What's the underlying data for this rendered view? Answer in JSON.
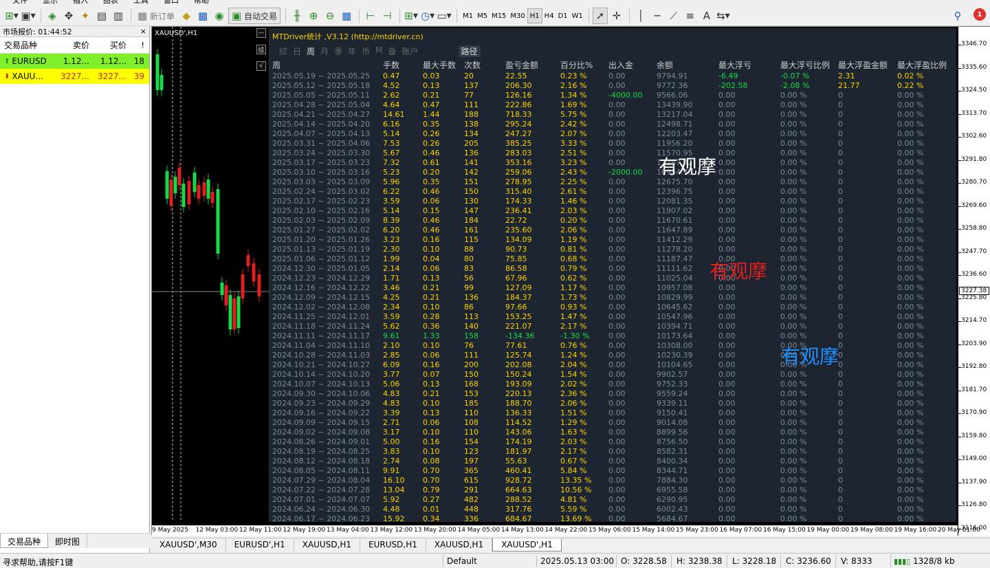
{
  "toolbar": {
    "menu": [
      "文件",
      "显示",
      "插入",
      "图表",
      "工具",
      "窗口",
      "帮助"
    ],
    "new_order_label": "新订单",
    "auto_trade_label": "自动交易",
    "timeframes": [
      "M1",
      "M5",
      "M15",
      "M30",
      "H1",
      "H4",
      "D1",
      "W1"
    ],
    "active_timeframe": "H1",
    "notifications": "1"
  },
  "market_watch": {
    "title": "市场报价: 01:44:52",
    "close": "×",
    "columns": [
      "交易品种",
      "卖价",
      "买价",
      "!"
    ],
    "rows": [
      {
        "symbol": "EURUSD",
        "bid": "1.12...",
        "ask": "1.12...",
        "spread": "18",
        "bg": "#7ff02a"
      },
      {
        "symbol": "XAUU...",
        "bid": "3227...",
        "ask": "3227...",
        "spread": "39",
        "bg": "#ffff00"
      }
    ],
    "tabs": [
      "交易品种",
      "即时图"
    ]
  },
  "chart": {
    "label": "XAUUSD',H1",
    "price_ticks": [
      "3346.70",
      "3335.60",
      "3324.50",
      "3313.70",
      "3302.60",
      "3291.80",
      "3280.70",
      "3269.60",
      "3258.80",
      "3247.70",
      "3236.60",
      "3225.80",
      "3214.70",
      "3203.90",
      "3192.80",
      "3181.70",
      "3170.90",
      "3159.80",
      "3149.00",
      "3137.90",
      "3126.80",
      "3116.00"
    ],
    "current_price": "3227.38",
    "time_ticks": [
      "9 May 2025",
      "12 May 03:00",
      "12 May 11:00",
      "12 May 19:00",
      "13 May 04:00",
      "13 May 12:00",
      "13 May 20:00",
      "14 May 05:00",
      "14 May 13:00",
      "14 May 22:00",
      "15 May 06:00",
      "15 May 14:00",
      "15 May 23:00",
      "16 May 07:00",
      "16 May 15:00",
      "19 May 00:00",
      "19 May 08:00",
      "19 May 16:00",
      "20 May 01:00"
    ],
    "side_buttons": [
      "—",
      "综",
      "√"
    ]
  },
  "panel": {
    "title": "MTDriver统计 ,V3.12 (http://mtdriver.cn)",
    "tabs": [
      "综",
      "日",
      "周",
      "月",
      "季",
      "年",
      "币",
      "M",
      "备",
      "账户"
    ],
    "route": "路径",
    "headers": [
      "周",
      "手数",
      "最大手数",
      "次数",
      "盈亏金额",
      "百分比%",
      "出入金",
      "余额",
      "最大浮亏",
      "最大浮亏比例",
      "最大浮盈金额",
      "最大浮盈比例"
    ],
    "rows": [
      [
        "2025.05.19 ~ 2025.05.25",
        "0.47",
        "0.03",
        "20",
        "22.55",
        "0.23 %",
        "0.00",
        "9794.91",
        "-6.49",
        "-0.07 %",
        "2.31",
        "0.02 %"
      ],
      [
        "2025.05.12 ~ 2025.05.18",
        "4.52",
        "0.13",
        "137",
        "206.30",
        "2.16 %",
        "0.00",
        "9772.36",
        "-202.58",
        "-2.08 %",
        "21.77",
        "0.22 %"
      ],
      [
        "2025.05.05 ~ 2025.05.11",
        "2.62",
        "0.21",
        "77",
        "126.16",
        "1.34 %",
        "-4000.00",
        "9566.06",
        "0.00",
        "0.00 %",
        "0",
        "0.00 %"
      ],
      [
        "2025.04.28 ~ 2025.05.04",
        "4.64",
        "0.47",
        "111",
        "222.86",
        "1.69 %",
        "0.00",
        "13439.90",
        "0.00",
        "0.00 %",
        "0",
        "0.00 %"
      ],
      [
        "2025.04.21 ~ 2025.04.27",
        "14.61",
        "1.44",
        "188",
        "718.33",
        "5.75 %",
        "0.00",
        "13217.04",
        "0.00",
        "0.00 %",
        "0",
        "0.00 %"
      ],
      [
        "2025.04.14 ~ 2025.04.20",
        "6.16",
        "0.35",
        "138",
        "295.24",
        "2.42 %",
        "0.00",
        "12498.71",
        "0.00",
        "0.00 %",
        "0",
        "0.00 %"
      ],
      [
        "2025.04.07 ~ 2025.04.13",
        "5.14",
        "0.26",
        "134",
        "247.27",
        "2.07 %",
        "0.00",
        "12203.47",
        "0.00",
        "0.00 %",
        "0",
        "0.00 %"
      ],
      [
        "2025.03.31 ~ 2025.04.06",
        "7.53",
        "0.26",
        "205",
        "385.25",
        "3.33 %",
        "0.00",
        "11956.20",
        "0.00",
        "0.00 %",
        "0",
        "0.00 %"
      ],
      [
        "2025.03.24 ~ 2025.03.30",
        "5.67",
        "0.46",
        "136",
        "283.03",
        "2.51 %",
        "0.00",
        "11570.95",
        "0.00",
        "0.00 %",
        "0",
        "0.00 %"
      ],
      [
        "2025.03.17 ~ 2025.03.23",
        "7.32",
        "0.61",
        "141",
        "353.16",
        "3.23 %",
        "0.00",
        "11287.92",
        "0.00",
        "0.00 %",
        "0",
        "0.00 %"
      ],
      [
        "2025.03.10 ~ 2025.03.16",
        "5.23",
        "0.20",
        "142",
        "259.06",
        "2.43 %",
        "-2000.00",
        "10934.76",
        "0.00",
        "0.00 %",
        "0",
        "0.00 %"
      ],
      [
        "2025.03.03 ~ 2025.03.09",
        "5.96",
        "0.35",
        "151",
        "278.95",
        "2.25 %",
        "0.00",
        "12675.70",
        "0.00",
        "0.00 %",
        "0",
        "0.00 %"
      ],
      [
        "2025.02.24 ~ 2025.03.02",
        "6.22",
        "0.46",
        "150",
        "315.40",
        "2.61 %",
        "0.00",
        "12396.75",
        "0.00",
        "0.00 %",
        "0",
        "0.00 %"
      ],
      [
        "2025.02.17 ~ 2025.02.23",
        "3.59",
        "0.06",
        "130",
        "174.33",
        "1.46 %",
        "0.00",
        "12081.35",
        "0.00",
        "0.00 %",
        "0",
        "0.00 %"
      ],
      [
        "2025.02.10 ~ 2025.02.16",
        "5.14",
        "0.15",
        "147",
        "236.41",
        "2.03 %",
        "0.00",
        "11907.02",
        "0.00",
        "0.00 %",
        "0",
        "0.00 %"
      ],
      [
        "2025.02.03 ~ 2025.02.09",
        "8.39",
        "0.46",
        "184",
        "22.72",
        "0.20 %",
        "0.00",
        "11670.61",
        "0.00",
        "0.00 %",
        "0",
        "0.00 %"
      ],
      [
        "2025.01.27 ~ 2025.02.02",
        "6.20",
        "0.46",
        "161",
        "235.60",
        "2.06 %",
        "0.00",
        "11647.89",
        "0.00",
        "0.00 %",
        "0",
        "0.00 %"
      ],
      [
        "2025.01.20 ~ 2025.01.26",
        "3.23",
        "0.16",
        "115",
        "134.09",
        "1.19 %",
        "0.00",
        "11412.29",
        "0.00",
        "0.00 %",
        "0",
        "0.00 %"
      ],
      [
        "2025.01.13 ~ 2025.01.19",
        "2.30",
        "0.10",
        "88",
        "90.73",
        "0.81 %",
        "0.00",
        "11278.20",
        "0.00",
        "0.00 %",
        "0",
        "0.00 %"
      ],
      [
        "2025.01.06 ~ 2025.01.12",
        "1.99",
        "0.04",
        "80",
        "75.85",
        "0.68 %",
        "0.00",
        "11187.47",
        "0.00",
        "0.00 %",
        "0",
        "0.00 %"
      ],
      [
        "2024.12.30 ~ 2025.01.05",
        "2.14",
        "0.06",
        "83",
        "86.58",
        "0.79 %",
        "0.00",
        "11111.62",
        "0.00",
        "0.00 %",
        "0",
        "0.00 %"
      ],
      [
        "2024.12.23 ~ 2024.12.29",
        "1.71",
        "0.13",
        "56",
        "67.96",
        "0.62 %",
        "0.00",
        "11025.04",
        "0.00",
        "0.00 %",
        "0",
        "0.00 %"
      ],
      [
        "2024.12.16 ~ 2024.12.22",
        "3.46",
        "0.21",
        "99",
        "127.09",
        "1.17 %",
        "0.00",
        "10957.08",
        "0.00",
        "0.00 %",
        "0",
        "0.00 %"
      ],
      [
        "2024.12.09 ~ 2024.12.15",
        "4.25",
        "0.21",
        "136",
        "184.37",
        "1.73 %",
        "0.00",
        "10829.99",
        "0.00",
        "0.00 %",
        "0",
        "0.00 %"
      ],
      [
        "2024.12.02 ~ 2024.12.08",
        "2.34",
        "0.10",
        "86",
        "97.66",
        "0.93 %",
        "0.00",
        "10645.62",
        "0.00",
        "0.00 %",
        "0",
        "0.00 %"
      ],
      [
        "2024.11.25 ~ 2024.12.01",
        "3.59",
        "0.28",
        "113",
        "153.25",
        "1.47 %",
        "0.00",
        "10547.96",
        "0.00",
        "0.00 %",
        "0",
        "0.00 %"
      ],
      [
        "2024.11.18 ~ 2024.11.24",
        "5.62",
        "0.36",
        "140",
        "221.07",
        "2.17 %",
        "0.00",
        "10394.71",
        "0.00",
        "0.00 %",
        "0",
        "0.00 %"
      ],
      [
        "2024.11.11 ~ 2024.11.17",
        "9.61",
        "1.33",
        "158",
        "-134.36",
        "-1.30 %",
        "0.00",
        "10173.64",
        "0.00",
        "0.00 %",
        "0",
        "0.00 %"
      ],
      [
        "2024.11.04 ~ 2024.11.10",
        "2.10",
        "0.10",
        "76",
        "77.61",
        "0.76 %",
        "0.00",
        "10308.00",
        "0.00",
        "0.00 %",
        "0",
        "0.00 %"
      ],
      [
        "2024.10.28 ~ 2024.11.03",
        "2.85",
        "0.06",
        "111",
        "125.74",
        "1.24 %",
        "0.00",
        "10230.39",
        "0.00",
        "0.00 %",
        "0",
        "0.00 %"
      ],
      [
        "2024.10.21 ~ 2024.10.27",
        "6.09",
        "0.16",
        "200",
        "202.08",
        "2.04 %",
        "0.00",
        "10104.65",
        "0.00",
        "0.00 %",
        "0",
        "0.00 %"
      ],
      [
        "2024.10.14 ~ 2024.10.20",
        "3.77",
        "0.07",
        "150",
        "150.24",
        "1.54 %",
        "0.00",
        "9902.57",
        "0.00",
        "0.00 %",
        "0",
        "0.00 %"
      ],
      [
        "2024.10.07 ~ 2024.10.13",
        "5.06",
        "0.13",
        "168",
        "193.09",
        "2.02 %",
        "0.00",
        "9752.33",
        "0.00",
        "0.00 %",
        "0",
        "0.00 %"
      ],
      [
        "2024.09.30 ~ 2024.10.06",
        "4.83",
        "0.21",
        "153",
        "220.13",
        "2.36 %",
        "0.00",
        "9559.24",
        "0.00",
        "0.00 %",
        "0",
        "0.00 %"
      ],
      [
        "2024.09.23 ~ 2024.09.29",
        "4.83",
        "0.10",
        "185",
        "188.70",
        "2.06 %",
        "0.00",
        "9339.11",
        "0.00",
        "0.00 %",
        "0",
        "0.00 %"
      ],
      [
        "2024.09.16 ~ 2024.09.22",
        "3.39",
        "0.13",
        "110",
        "136.33",
        "1.51 %",
        "0.00",
        "9150.41",
        "0.00",
        "0.00 %",
        "0",
        "0.00 %"
      ],
      [
        "2024.09.09 ~ 2024.09.15",
        "2.71",
        "0.06",
        "108",
        "114.52",
        "1.29 %",
        "0.00",
        "9014.08",
        "0.00",
        "0.00 %",
        "0",
        "0.00 %"
      ],
      [
        "2024.09.02 ~ 2024.09.08",
        "3.17",
        "0.10",
        "110",
        "143.06",
        "1.63 %",
        "0.00",
        "8899.56",
        "0.00",
        "0.00 %",
        "0",
        "0.00 %"
      ],
      [
        "2024.08.26 ~ 2024.09.01",
        "5.00",
        "0.16",
        "154",
        "174.19",
        "2.03 %",
        "0.00",
        "8756.50",
        "0.00",
        "0.00 %",
        "0",
        "0.00 %"
      ],
      [
        "2024.08.19 ~ 2024.08.25",
        "3.83",
        "0.10",
        "123",
        "181.97",
        "2.17 %",
        "0.00",
        "8582.31",
        "0.00",
        "0.00 %",
        "0",
        "0.00 %"
      ],
      [
        "2024.08.12 ~ 2024.08.18",
        "2.74",
        "0.08",
        "197",
        "55.63",
        "0.67 %",
        "0.00",
        "8400.34",
        "0.00",
        "0.00 %",
        "0",
        "0.00 %"
      ],
      [
        "2024.08.05 ~ 2024.08.11",
        "9.91",
        "0.70",
        "365",
        "460.41",
        "5.84 %",
        "0.00",
        "8344.71",
        "0.00",
        "0.00 %",
        "0",
        "0.00 %"
      ],
      [
        "2024.07.29 ~ 2024.08.04",
        "16.10",
        "0.70",
        "615",
        "928.72",
        "13.35 %",
        "0.00",
        "7884.30",
        "0.00",
        "0.00 %",
        "0",
        "0.00 %"
      ],
      [
        "2024.07.22 ~ 2024.07.28",
        "13.04",
        "0.79",
        "291",
        "664.63",
        "10.56 %",
        "0.00",
        "6955.58",
        "0.00",
        "0.00 %",
        "0",
        "0.00 %"
      ],
      [
        "2024.07.01 ~ 2024.07.07",
        "5.92",
        "0.27",
        "482",
        "288.52",
        "4.81 %",
        "0.00",
        "6290.95",
        "0.00",
        "0.00 %",
        "0",
        "0.00 %"
      ],
      [
        "2024.06.24 ~ 2024.06.30",
        "4.48",
        "0.01",
        "448",
        "317.76",
        "5.59 %",
        "0.00",
        "6002.43",
        "0.00",
        "0.00 %",
        "0",
        "0.00 %"
      ],
      [
        "2024.06.17 ~ 2024.06.23",
        "15.92",
        "0.34",
        "336",
        "684.67",
        "13.69 %",
        "0.00",
        "5684.67",
        "0.00",
        "0.00 %",
        "0",
        "0.00 %"
      ]
    ],
    "watermarks": [
      {
        "text": "有观摩",
        "color": "#ffffff"
      },
      {
        "text": "有观摩",
        "color": "#e02020"
      },
      {
        "text": "有观摩",
        "color": "#1e90ff"
      }
    ]
  },
  "chart_tabs": [
    "XAUUSD',M30",
    "EURUSD',H1",
    "XAUUSD,H1",
    "EURUSD,H1",
    "XAUUSD,H1",
    "XAUUSD',H1"
  ],
  "active_chart_tab": "XAUUSD',H1",
  "status": {
    "help": "寻求帮助,请按F1键",
    "profile": "Default",
    "datetime": "2025.05.13 03:00",
    "open": "O: 3228.58",
    "high": "H: 3238.38",
    "low": "L: 3228.18",
    "close": "C: 3236.60",
    "volume": "V: 8333",
    "traffic": "1328/8 kb"
  }
}
